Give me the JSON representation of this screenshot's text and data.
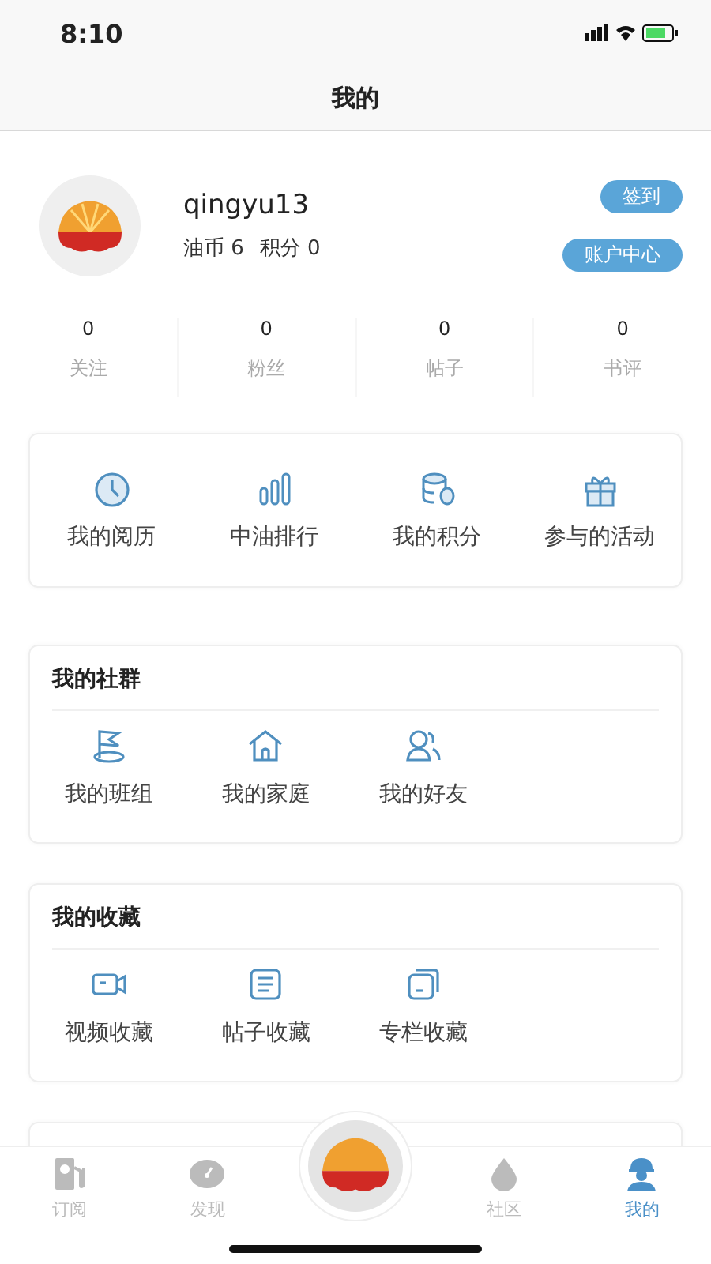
{
  "status_bar": {
    "time": "8:10"
  },
  "header": {
    "title": "我的"
  },
  "profile": {
    "username": "qingyu13",
    "coins_label": "油币",
    "coins": "6",
    "points_label": "积分",
    "points": "0",
    "sign_in_button": "签到",
    "account_button": "账户中心"
  },
  "stats": [
    {
      "value": "0",
      "label": "关注"
    },
    {
      "value": "0",
      "label": "粉丝"
    },
    {
      "value": "0",
      "label": "帖子"
    },
    {
      "value": "0",
      "label": "书评"
    }
  ],
  "quick_actions": [
    "我的阅历",
    "中油排行",
    "我的积分",
    "参与的活动"
  ],
  "sections": [
    {
      "title": "我的社群",
      "items": [
        "我的班组",
        "我的家庭",
        "我的好友"
      ]
    },
    {
      "title": "我的收藏",
      "items": [
        "视频收藏",
        "帖子收藏",
        "专栏收藏"
      ]
    }
  ],
  "tab_bar": [
    {
      "label": "订阅",
      "selected": false
    },
    {
      "label": "发现",
      "selected": false
    },
    {
      "kind": "center"
    },
    {
      "label": "社区",
      "selected": false
    },
    {
      "label": "我的",
      "selected": true
    }
  ]
}
